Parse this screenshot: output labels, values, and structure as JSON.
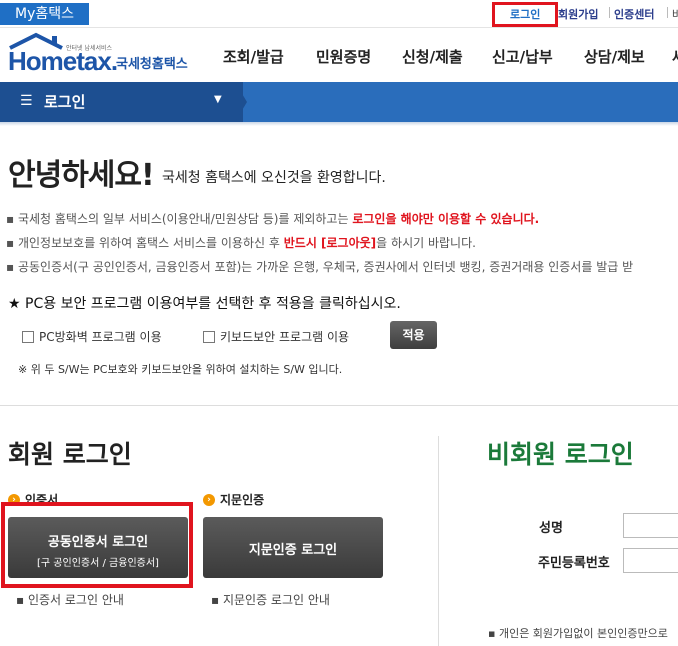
{
  "topbar": {
    "my_hometax": "My홈택스",
    "login": "로그인",
    "join": "회원가입",
    "cert_center": "인증센터",
    "partial": "바"
  },
  "logo": {
    "brand_small": "안터넷 납세서비스",
    "brand_en": "Hometax.",
    "brand_kr": "국세청홈택스"
  },
  "menu": [
    "조회/발급",
    "민원증명",
    "신청/제출",
    "신고/납부",
    "상담/제보",
    "세"
  ],
  "band": {
    "label": "로그인"
  },
  "greeting": {
    "title": "안녕하세요!",
    "subtitle": "국세청 홈택스에 오신것을 환영합니다."
  },
  "notices": [
    {
      "pre": "국세청 홈택스의 일부 서비스(이용안내/민원상담 등)를 제외하고는 ",
      "red": "로그인을 해야만 이용할 수 있습니다.",
      "post": ""
    },
    {
      "pre": "개인정보보호를 위하여 홈택스 서비스를 이용하신 후 ",
      "red": "반드시 [로그아웃]",
      "post": "을 하시기 바랍니다."
    },
    {
      "pre": "공동인증서(구 공인인증서, 금융인증서 포함)는 가까운 은행, 우체국, 증권사에서 인터넷 뱅킹, 증권거래용 인증서를 발급 받",
      "red": "",
      "post": ""
    }
  ],
  "security": {
    "title": "PC용 보안 프로그램 이용여부를 선택한 후 적용을 클릭하십시오.",
    "firewall": "PC방화벽 프로그램 이용",
    "keyboard": "키보드보안 프로그램 이용",
    "apply": "적용",
    "note": "※ 위 두 S/W는 PC보호와 키보드보안을 위하여 설치하는 S/W 입니다."
  },
  "member": {
    "title": "회원 로그인",
    "cert_head": "인증서",
    "finger_head": "지문인증",
    "cert_btn_l1": "공동인증서 로그인",
    "cert_btn_l2": "[구 공인인증서 / 금융인증서]",
    "finger_btn": "지문인증 로그인",
    "cert_guide": "인증서 로그인 안내",
    "finger_guide": "지문인증 로그인 안내"
  },
  "nonmember": {
    "title": "비회원 로그인",
    "name_label": "성명",
    "rrn_label": "주민등록번호",
    "note": "개인은 회원가입없이 본인인증만으로"
  }
}
